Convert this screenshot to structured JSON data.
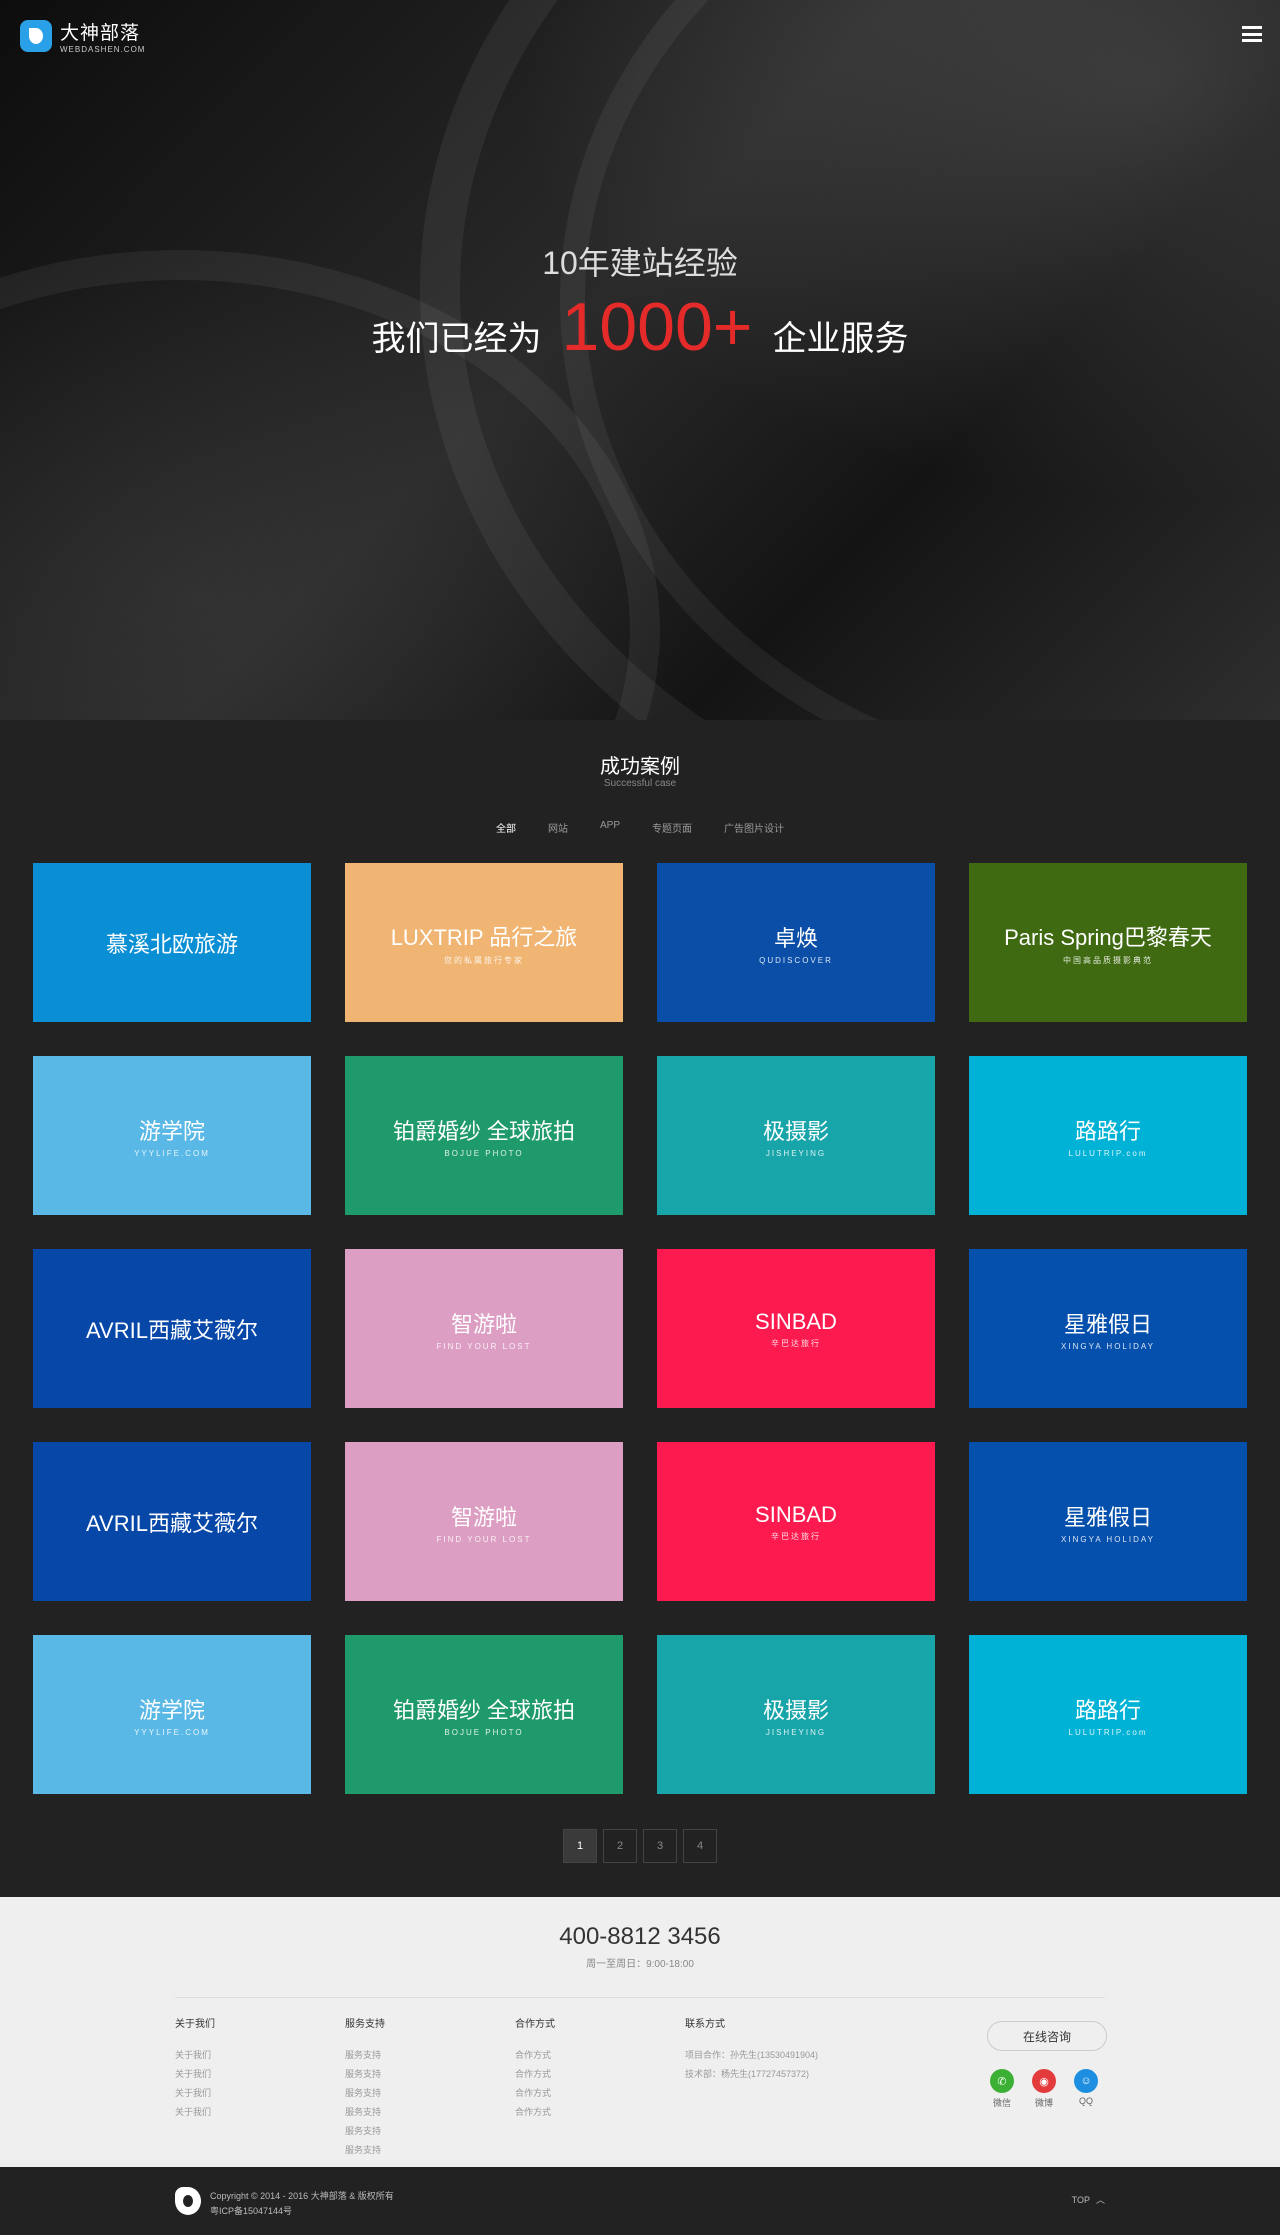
{
  "header": {
    "logo_name": "大神部落",
    "logo_sub": "WEBDASHEN.COM"
  },
  "hero": {
    "line1": "10年建站经验",
    "line2_prefix": "我们已经为",
    "line2_number": "1000+",
    "line2_suffix": "企业服务"
  },
  "cases": {
    "title": "成功案例",
    "subtitle": "Successful case",
    "filters": [
      "全部",
      "网站",
      "APP",
      "专题页面",
      "广告图片设计"
    ],
    "tiles": [
      {
        "label": "慕溪北欧旅游",
        "sub": "",
        "color": "#0a8fd4"
      },
      {
        "label": "LUXTRIP 品行之旅",
        "sub": "您的私属旅行专家",
        "color": "#f0b573"
      },
      {
        "label": "卓焕",
        "sub": "QUDISCOVER",
        "color": "#0a4ea8"
      },
      {
        "label": "Paris Spring巴黎春天",
        "sub": "中国高品质摄影典范",
        "color": "#3f6a12"
      },
      {
        "label": "游学院",
        "sub": "YYYLIFE.COM",
        "color": "#5ab8e6"
      },
      {
        "label": "铂爵婚纱 全球旅拍",
        "sub": "BOJUE PHOTO",
        "color": "#1f9b6b"
      },
      {
        "label": "极摄影",
        "sub": "JISHEYING",
        "color": "#17a5aa"
      },
      {
        "label": "路路行",
        "sub": "LULUTRIP.com",
        "color": "#00b3d6"
      },
      {
        "label": "AVRIL西藏艾薇尔",
        "sub": "",
        "color": "#0647a8"
      },
      {
        "label": "智游啦",
        "sub": "FIND YOUR LOST",
        "color": "#dc9ec2"
      },
      {
        "label": "SINBAD",
        "sub": "辛巴达旅行",
        "color": "#fc1a4f"
      },
      {
        "label": "星雅假日",
        "sub": "XINGYA HOLIDAY",
        "color": "#0650ad"
      },
      {
        "label": "AVRIL西藏艾薇尔",
        "sub": "",
        "color": "#0647a8"
      },
      {
        "label": "智游啦",
        "sub": "FIND YOUR LOST",
        "color": "#dc9ec2"
      },
      {
        "label": "SINBAD",
        "sub": "辛巴达旅行",
        "color": "#fc1a4f"
      },
      {
        "label": "星雅假日",
        "sub": "XINGYA HOLIDAY",
        "color": "#0650ad"
      },
      {
        "label": "游学院",
        "sub": "YYYLIFE.COM",
        "color": "#5ab8e6"
      },
      {
        "label": "铂爵婚纱 全球旅拍",
        "sub": "BOJUE PHOTO",
        "color": "#1f9b6b"
      },
      {
        "label": "极摄影",
        "sub": "JISHEYING",
        "color": "#17a5aa"
      },
      {
        "label": "路路行",
        "sub": "LULUTRIP.com",
        "color": "#00b3d6"
      }
    ],
    "pages": [
      "1",
      "2",
      "3",
      "4"
    ]
  },
  "footer": {
    "phone": "400-8812 3456",
    "hours": "周一至周日：9:00-18:00",
    "col1": {
      "title": "关于我们",
      "items": [
        "关于我们",
        "关于我们",
        "关于我们",
        "关于我们"
      ]
    },
    "col2": {
      "title": "服务支持",
      "items": [
        "服务支持",
        "服务支持",
        "服务支持",
        "服务支持",
        "服务支持",
        "服务支持"
      ]
    },
    "col3": {
      "title": "合作方式",
      "items": [
        "合作方式",
        "合作方式",
        "合作方式",
        "合作方式"
      ]
    },
    "col4": {
      "title": "联系方式",
      "items": [
        "项目合作：孙先生(13530491904)",
        "技术部：杨先生(17727457372)"
      ]
    },
    "consult_label": "在线咨询",
    "social": [
      {
        "label": "微信",
        "color": "#3cb034"
      },
      {
        "label": "微博",
        "color": "#e33b3b"
      },
      {
        "label": "QQ",
        "color": "#1e8fe0"
      }
    ]
  },
  "bottom": {
    "copyright": "Copyright © 2014 - 2016 大神部落 & 版权所有",
    "icp": "粤ICP备15047144号",
    "top_label": "TOP"
  }
}
